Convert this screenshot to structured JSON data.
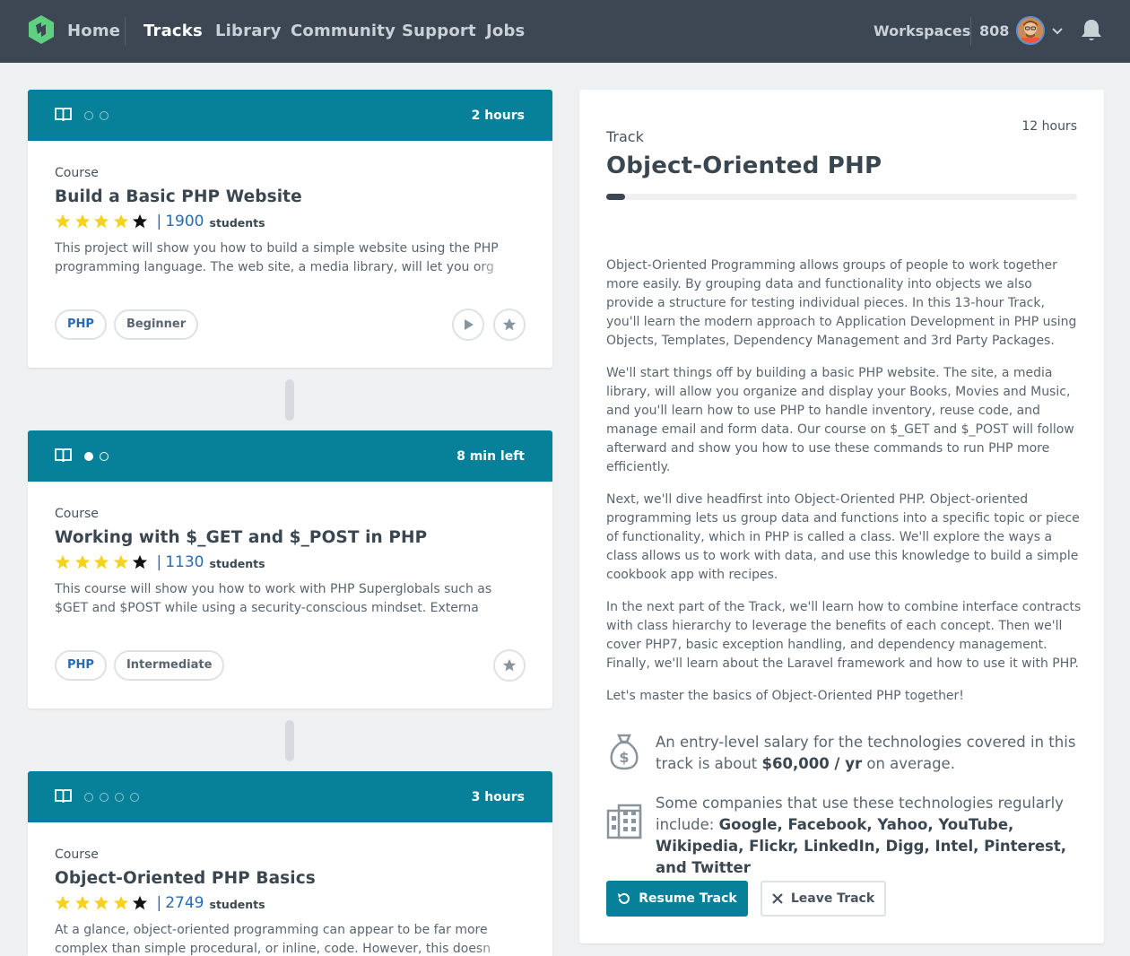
{
  "nav": {
    "links": [
      "Home",
      "Tracks",
      "Library",
      "Community",
      "Support",
      "Jobs"
    ],
    "active": "Tracks",
    "workspaces": "Workspaces",
    "points": "808"
  },
  "courses": [
    {
      "time": "2 hours",
      "type": "Course",
      "title": "Build a Basic PHP Website",
      "rating": 4,
      "students_count": "1900",
      "students_label": "students",
      "description": "This project will show you how to build a simple website using the PHP programming language. The web site, a media library, will let you org",
      "tags": [
        "PHP",
        "Beginner"
      ],
      "progress_steps": {
        "total": 2,
        "done": 0
      },
      "actions": [
        "play",
        "star"
      ]
    },
    {
      "time": "8 min left",
      "type": "Course",
      "title": "Working with $_GET and $_POST in PHP",
      "rating": 4,
      "students_count": "1130",
      "students_label": "students",
      "description": "This course will show you how to work with PHP Superglobals such as $GET and $POST while using a security-conscious mindset. Externa",
      "tags": [
        "PHP",
        "Intermediate"
      ],
      "progress_steps": {
        "total": 2,
        "done": 1
      },
      "actions": [
        "star"
      ]
    },
    {
      "time": "3 hours",
      "type": "Course",
      "title": "Object-Oriented PHP Basics",
      "rating": 4,
      "students_count": "2749",
      "students_label": "students",
      "description": "At a glance, object-oriented programming can appear to be far more complex than simple procedural, or inline, code. However, this doesn",
      "tags": [],
      "progress_steps": {
        "total": 4,
        "done": 0
      },
      "actions": []
    }
  ],
  "track": {
    "type": "Track",
    "title": "Object-Oriented PHP",
    "hours": "12 hours",
    "progress": 0.04,
    "paragraphs": [
      "Object-Oriented Programming allows groups of people to work together more easily. By grouping data and functionality into objects we also provide a structure for testing individual pieces. In this 13-hour Track, you'll learn the modern approach to Application Development in PHP using Objects, Templates, Dependency Management and 3rd Party Packages.",
      "We'll start things off by building a basic PHP website. The site, a media library, will allow you organize and display your Books, Movies and Music, and you'll learn how to use PHP to handle inventory, reuse code, and manage email and form data. Our course on $_GET and $_POST will follow afterward and show you how to use these commands to run PHP more efficiently.",
      "Next, we'll dive headfirst into Object-Oriented PHP. Object-oriented programming lets us group data and functions into a specific topic or piece of functionality, which in PHP is called a class. We'll explore the ways a class allows us to work with data, and use this knowledge to build a simple cookbook app with recipes.",
      "In the next part of the Track, we'll learn how to combine interface contracts with class hierarchy to leverage the benefits of each concept. Then we'll cover PHP7, basic exception handling, and dependency management. Finally, we'll learn about the Laravel framework and how to use it with PHP.",
      "Let's master the basics of Object-Oriented PHP together!"
    ],
    "salary_prefix": "An entry-level salary for the technologies covered in this track is about",
    "salary_value": "$60,000 / yr",
    "salary_suffix": "on average.",
    "companies_prefix": "Some companies that use these technologies regularly include:",
    "companies_list": "Google, Facebook, Yahoo, YouTube, Wikipedia, Flickr, LinkedIn, Digg, Intel, Pinterest, and Twitter",
    "resume_label": "Resume Track",
    "leave_label": "Leave Track"
  },
  "colors": {
    "nav_bg": "#3d4753",
    "accent": "#07809a",
    "link": "#2a6bb0",
    "star": "#f5d21c"
  }
}
